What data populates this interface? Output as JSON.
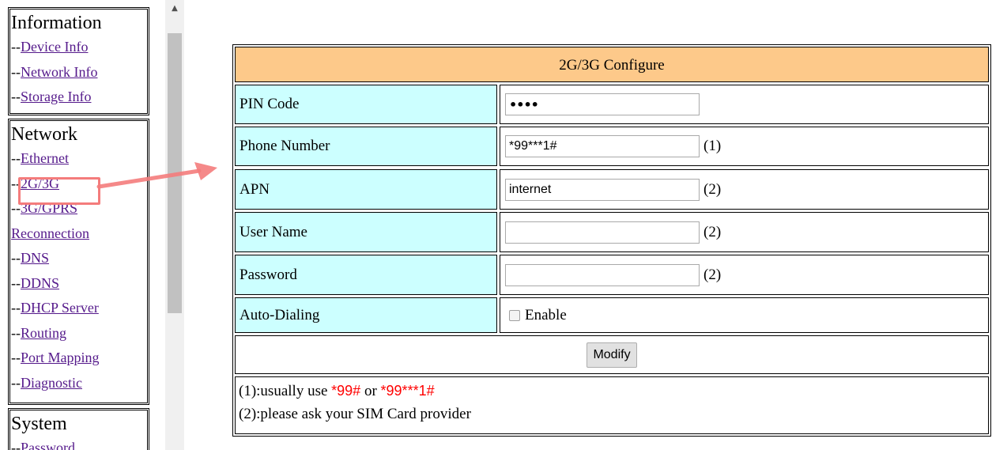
{
  "nav": {
    "information": {
      "header": "Information",
      "items": [
        "Device Info",
        "Network Info",
        "Storage Info"
      ]
    },
    "network": {
      "header": "Network",
      "items": [
        "Ethernet",
        "2G/3G",
        "3G/GPRS Reconnection",
        "DNS",
        "DDNS",
        "DHCP Server",
        "Routing",
        "Port Mapping",
        "Diagnostic"
      ]
    },
    "system": {
      "header": "System",
      "items": [
        "Password"
      ]
    },
    "prefix": "--"
  },
  "config": {
    "title": "2G/3G Configure",
    "fields": {
      "pin_code": {
        "label": "PIN Code",
        "value": "••••"
      },
      "phone_number": {
        "label": "Phone Number",
        "value": "*99***1#",
        "note": "(1)"
      },
      "apn": {
        "label": "APN",
        "value": "internet",
        "note": "(2)"
      },
      "user_name": {
        "label": "User Name",
        "value": "",
        "note": "(2)"
      },
      "password": {
        "label": "Password",
        "value": "",
        "note": "(2)"
      },
      "auto_dialing": {
        "label": "Auto-Dialing",
        "checkbox_label": "Enable",
        "checked": false
      }
    },
    "modify_label": "Modify",
    "notes": {
      "line1_prefix": "(1):usually use ",
      "line1_code1": "*99#",
      "line1_mid": " or ",
      "line1_code2": "*99***1#",
      "line2": "(2):please ask your SIM Card provider"
    }
  },
  "colors": {
    "title_bg": "#fdc98a",
    "label_bg": "#ccffff",
    "link": "#551a8b",
    "highlight": "#f47c7c",
    "note_red": "#ff0000"
  },
  "icons": {
    "scroll_up": "scroll-up-arrow-icon",
    "annotation_arrow": "arrow-right-icon"
  }
}
